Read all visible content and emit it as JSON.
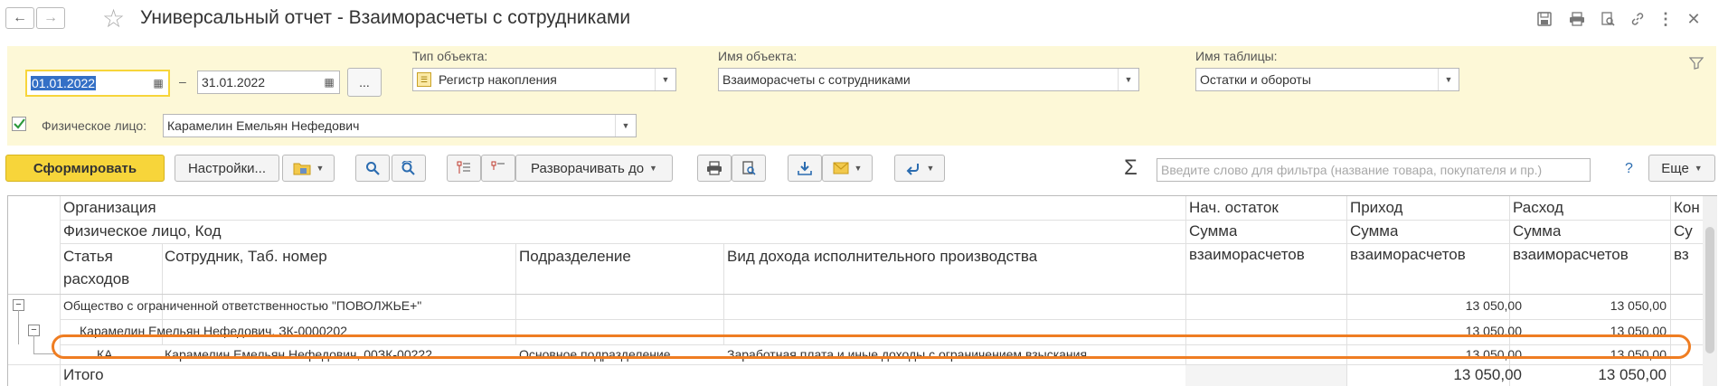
{
  "window": {
    "title": "Универсальный отчет - Взаиморасчеты с сотрудниками"
  },
  "filters": {
    "date_from": "01.01.2022",
    "date_sep": "–",
    "date_to": "31.01.2022",
    "period_btn": "...",
    "object_type_label": "Тип объекта:",
    "object_type_value": "Регистр накопления",
    "object_name_label": "Имя объекта:",
    "object_name_value": "Взаиморасчеты с сотрудниками",
    "table_name_label": "Имя таблицы:",
    "table_name_value": "Остатки и обороты",
    "person_checked": true,
    "person_label": "Физическое лицо:",
    "person_value": "Карамелин Емельян Нефедович"
  },
  "toolbar": {
    "generate": "Сформировать",
    "settings": "Настройки...",
    "expand_to": "Разворачивать до",
    "search_placeholder": "Введите слово для фильтра (название товара, покупателя и пр.)",
    "help": "?",
    "more": "Еще"
  },
  "report": {
    "headers": {
      "org": "Организация",
      "person_code": "Физическое лицо, Код",
      "expense_item_1": "Статья",
      "expense_item_2": "расходов",
      "employee": "Сотрудник, Таб. номер",
      "department": "Подразделение",
      "income_type": "Вид дохода исполнительного производства",
      "opening": "Нач. остаток",
      "opening_sub_1": "Сумма",
      "opening_sub_2": "взаиморасчетов",
      "income": "Приход",
      "income_sub_1": "Сумма",
      "income_sub_2": "взаиморасчетов",
      "expense": "Расход",
      "expense_sub_1": "Сумма",
      "expense_sub_2": "взаиморасчетов",
      "closing": "Кон",
      "closing_sub_1": "Су",
      "closing_sub_2": "вз"
    },
    "rows": [
      {
        "name": "Общество с ограниченной ответственностью \"ПОВОЛЖЬЕ+\"",
        "income": "13 050,00",
        "expense": "13 050,00"
      },
      {
        "name": "Карамелин Емельян Нефедович, ЗК-0000202",
        "income": "13 050,00",
        "expense": "13 050,00"
      },
      {
        "item": "КА",
        "employee": "Карамелин Емельян Нефедович, 00ЗК-00222",
        "department": "Основное подразделение",
        "income_type": "Заработная плата и иные доходы с ограничением взыскания",
        "income": "13 050,00",
        "expense": "13 050,00"
      }
    ],
    "total": {
      "label": "Итого",
      "income": "13 050,00",
      "expense": "13 050,00"
    }
  },
  "colors": {
    "accent_yellow": "#f7d53a",
    "filter_panel": "#fdf8d7",
    "highlight_outline": "#ef7d22"
  }
}
